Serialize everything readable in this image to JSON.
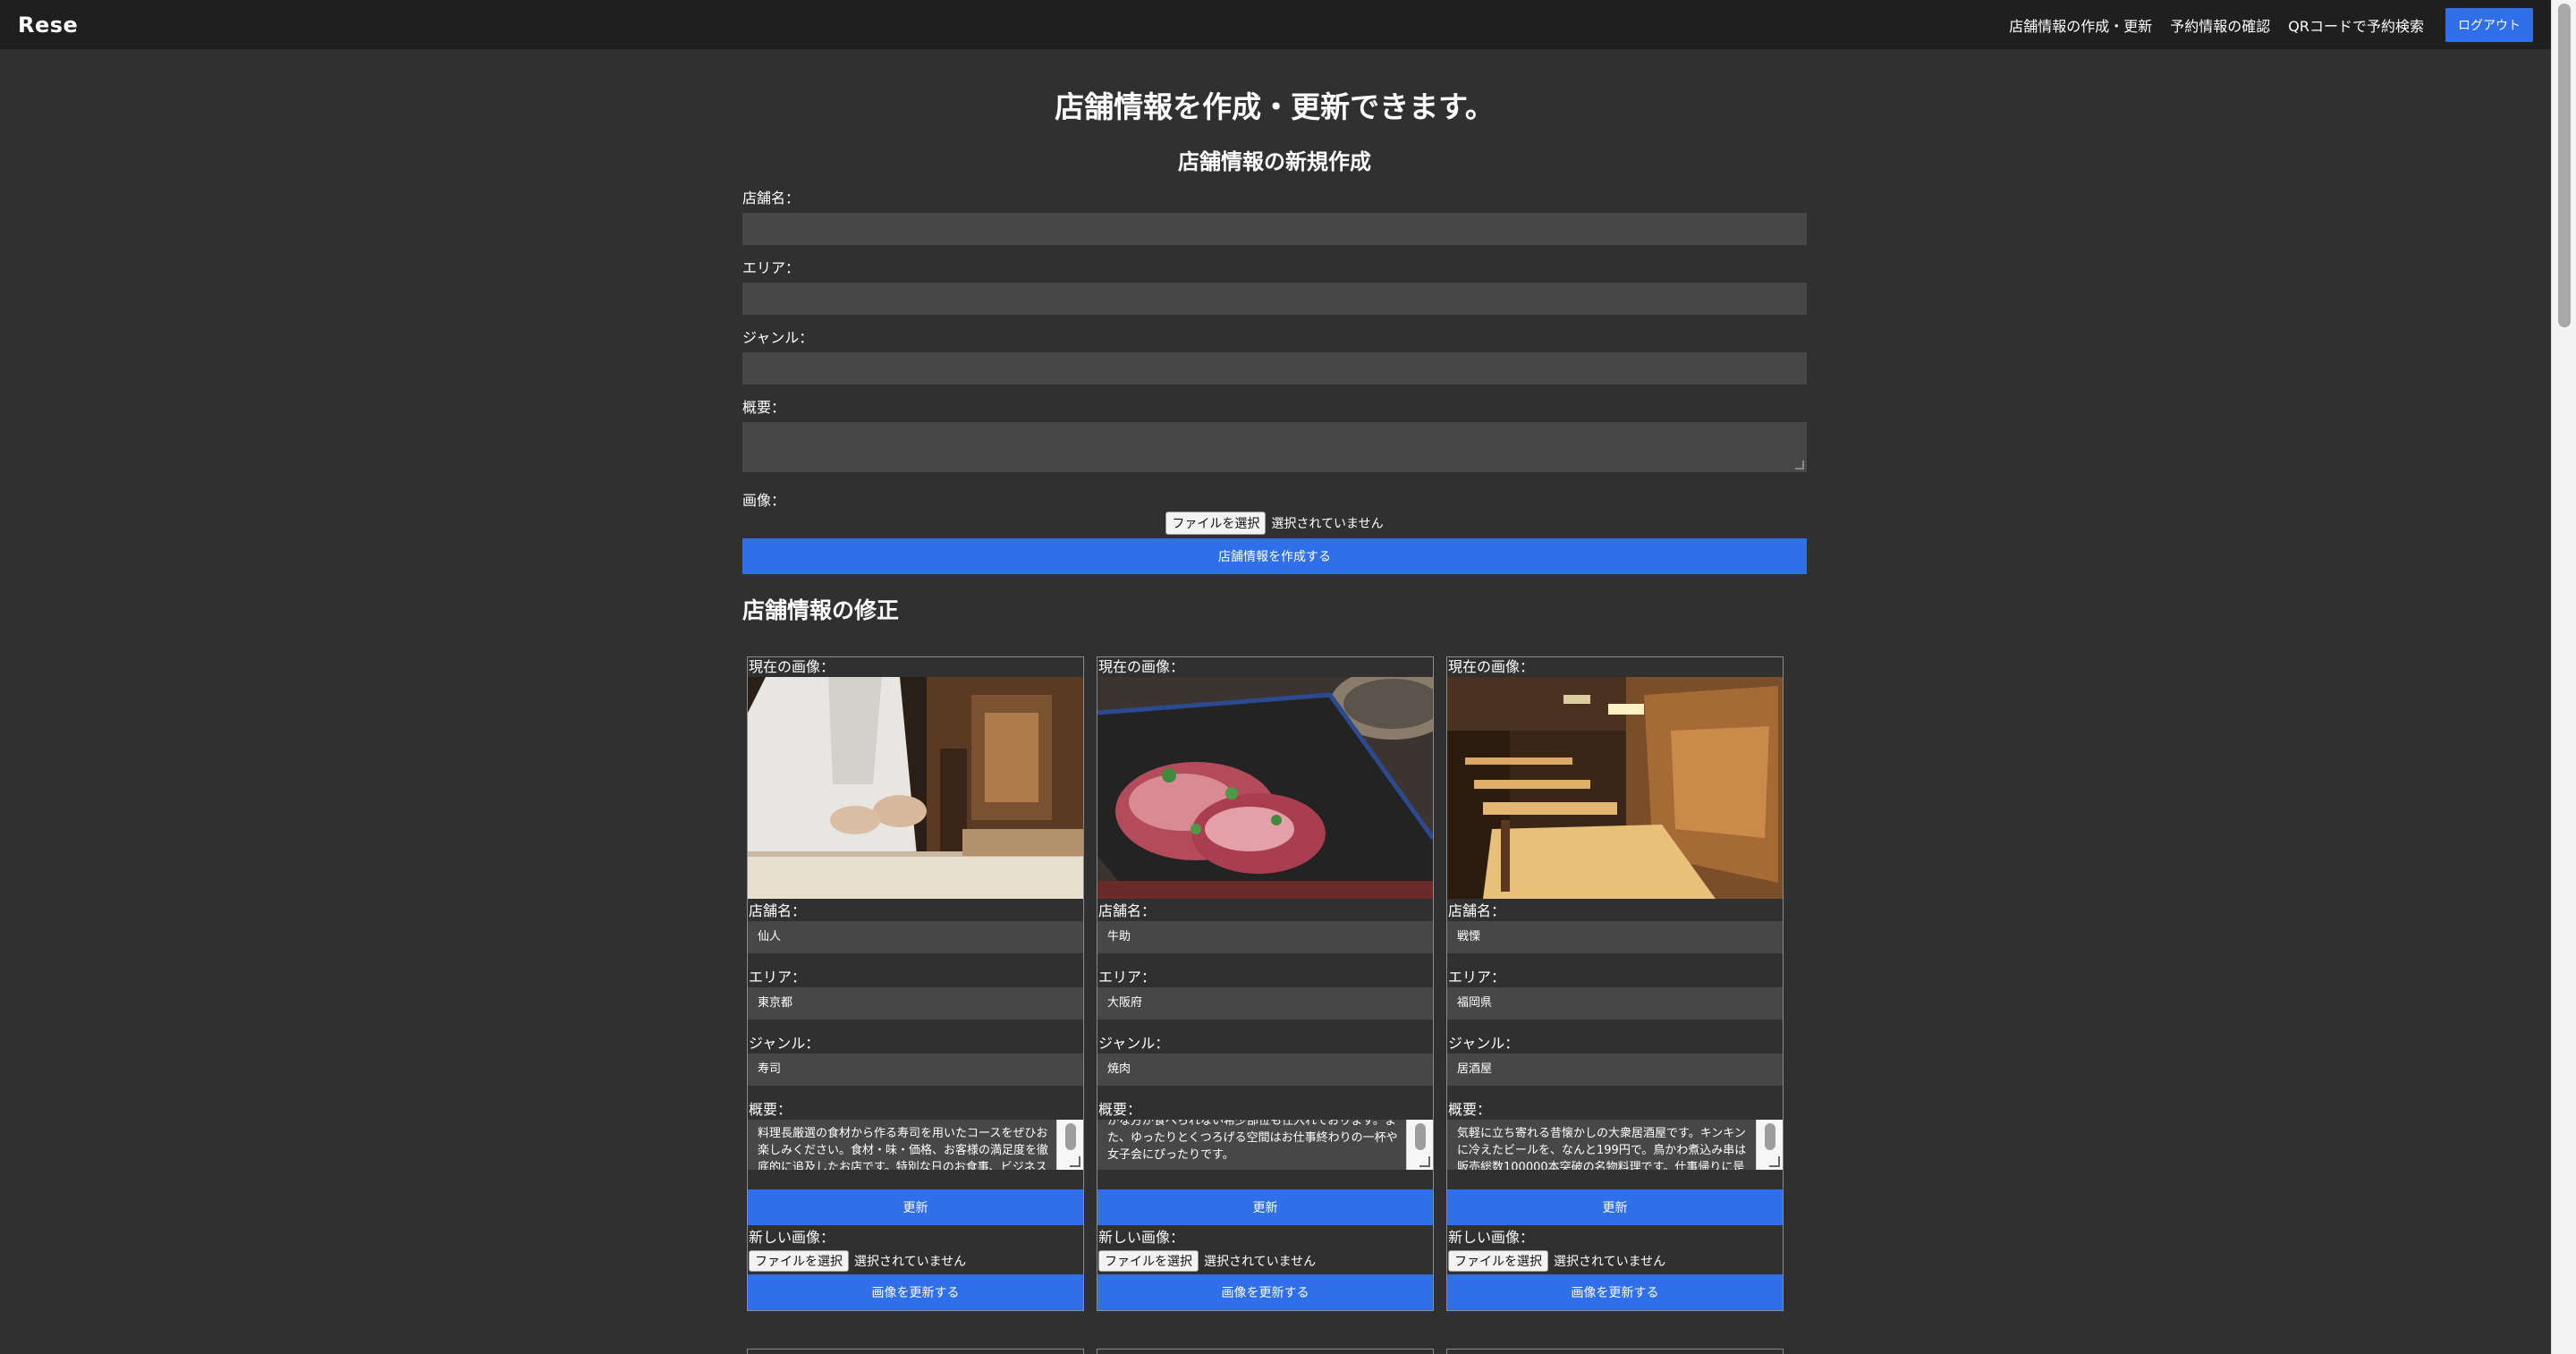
{
  "header": {
    "logo": "Rese",
    "nav": {
      "create_update": "店舗情報の作成・更新",
      "reservations": "予約情報の確認",
      "qr_search": "QRコードで予約検索",
      "logout": "ログアウト"
    }
  },
  "page": {
    "title": "店舗情報を作成・更新できます。",
    "create_section_title": "店舗情報の新規作成",
    "edit_section_title": "店舗情報の修正"
  },
  "create_form": {
    "name_label": "店舗名：",
    "area_label": "エリア：",
    "genre_label": "ジャンル：",
    "summary_label": "概要：",
    "image_label": "画像：",
    "file_button": "ファイルを選択",
    "file_status": "選択されていません",
    "submit": "店舗情報を作成する"
  },
  "card_labels": {
    "current_image": "現在の画像：",
    "name": "店舗名：",
    "area": "エリア：",
    "genre": "ジャンル：",
    "summary": "概要：",
    "update": "更新",
    "new_image": "新しい画像：",
    "file_button": "ファイルを選択",
    "file_status": "選択されていません",
    "update_image": "画像を更新する"
  },
  "shops": [
    {
      "image": "sushi-chef-icon",
      "name": "仙人",
      "area": "東京都",
      "genre": "寿司",
      "summary": "料理長厳選の食材から作る寿司を用いたコースをぜひお楽しみください。食材・味・価格、お客様の満足度を徹底的に追及したお店です。特別な日のお食事、ビジネス接待まで"
    },
    {
      "image": "yakiniku-meat-icon",
      "name": "牛助",
      "area": "大阪府",
      "genre": "焼肉",
      "summary": "かな方が食べられない希少部位も仕入れております。また、ゆったりとくつろげる空間はお仕事終わりの一杯や女子会にぴったりです。"
    },
    {
      "image": "izakaya-interior-icon",
      "name": "戦慄",
      "area": "福岡県",
      "genre": "居酒屋",
      "summary": "気軽に立ち寄れる昔懐かしの大衆居酒屋です。キンキンに冷えたビールを、なんと199円で。鳥かわ煮込み串は販売総数100000本突破の名物料理です。仕事帰りに是非"
    }
  ],
  "colors": {
    "background": "#303030",
    "header": "#1f1f1f",
    "input": "#474747",
    "accent": "#2f6fe9"
  }
}
